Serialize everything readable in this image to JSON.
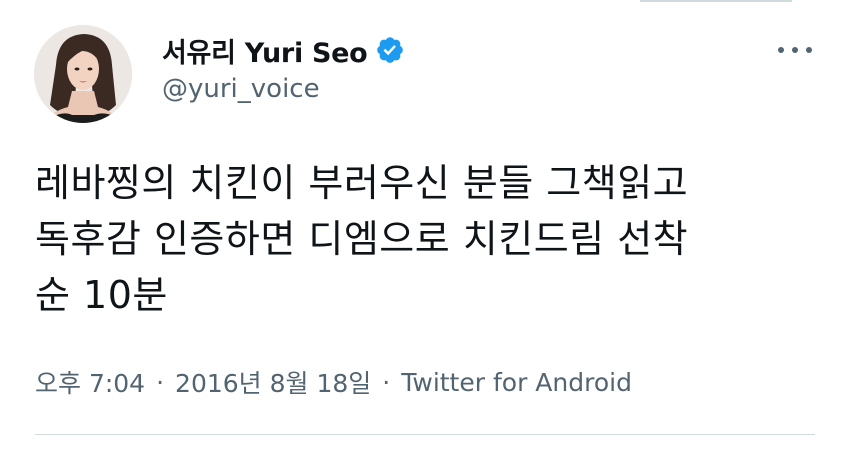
{
  "tweet": {
    "author": {
      "display_name": "서유리 Yuri Seo",
      "handle": "@yuri_voice",
      "verified": true,
      "avatar_icon": "profile-photo"
    },
    "text_lines": [
      "레바찡의 치킨이 부러우신 분들 그책읽고",
      "독후감 인증하면 디엠으로 치킨드림 선착",
      "순 10분"
    ],
    "time": "오후 7:04",
    "separator": "·",
    "date": "2016년 8월 18일",
    "source": "Twitter for Android",
    "more_icon": "more-horizontal-icon"
  },
  "colors": {
    "text_primary": "#0f1419",
    "text_secondary": "#536471",
    "verified_blue": "#1d9bf0",
    "divider": "#cfd9de"
  }
}
